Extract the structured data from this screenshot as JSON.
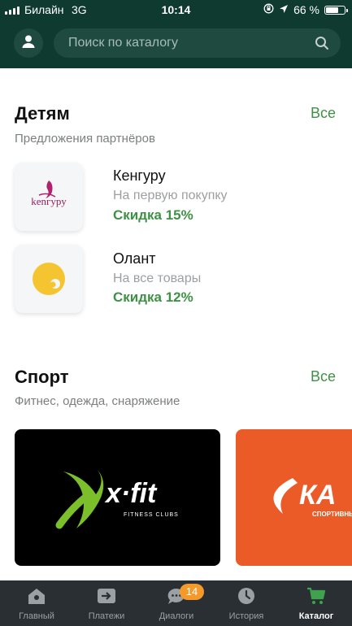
{
  "status_bar": {
    "carrier": "Билайн",
    "network": "3G",
    "time": "10:14",
    "battery_percent": "66 %",
    "battery_level": 0.66
  },
  "header": {
    "search_placeholder": "Поиск по каталогу"
  },
  "sections": {
    "kids": {
      "title": "Детям",
      "all_label": "Все",
      "subtitle": "Предложения партнёров",
      "partners": [
        {
          "name": "Кенгуру",
          "desc": "На первую покупку",
          "discount": "Скидка 15%",
          "logo_text": "kenгуру"
        },
        {
          "name": "Олант",
          "desc": "На все товары",
          "discount": "Скидка 12%"
        }
      ]
    },
    "sport": {
      "title": "Спорт",
      "all_label": "Все",
      "subtitle": "Фитнес, одежда, снаряжение",
      "cards": [
        {
          "logo_main": "x·fit",
          "logo_sub": "FITNESS CLUBS"
        },
        {
          "logo_main": "КА",
          "logo_sub": "СПОРТИВНЫ"
        }
      ]
    }
  },
  "tabbar": {
    "tabs": [
      {
        "label": "Главный",
        "icon": "home-icon"
      },
      {
        "label": "Платежи",
        "icon": "transfer-icon"
      },
      {
        "label": "Диалоги",
        "icon": "chat-icon"
      },
      {
        "label": "История",
        "icon": "clock-icon"
      },
      {
        "label": "Каталог",
        "icon": "cart-icon"
      }
    ],
    "active": "Каталог",
    "dialogs_badge": "14"
  },
  "colors": {
    "header_bg": "#0f3a30",
    "accent_green": "#3f9146",
    "tabbar_bg": "#2a2f33",
    "badge": "#f39a2b",
    "active_tab_icon": "#3fa34d"
  }
}
